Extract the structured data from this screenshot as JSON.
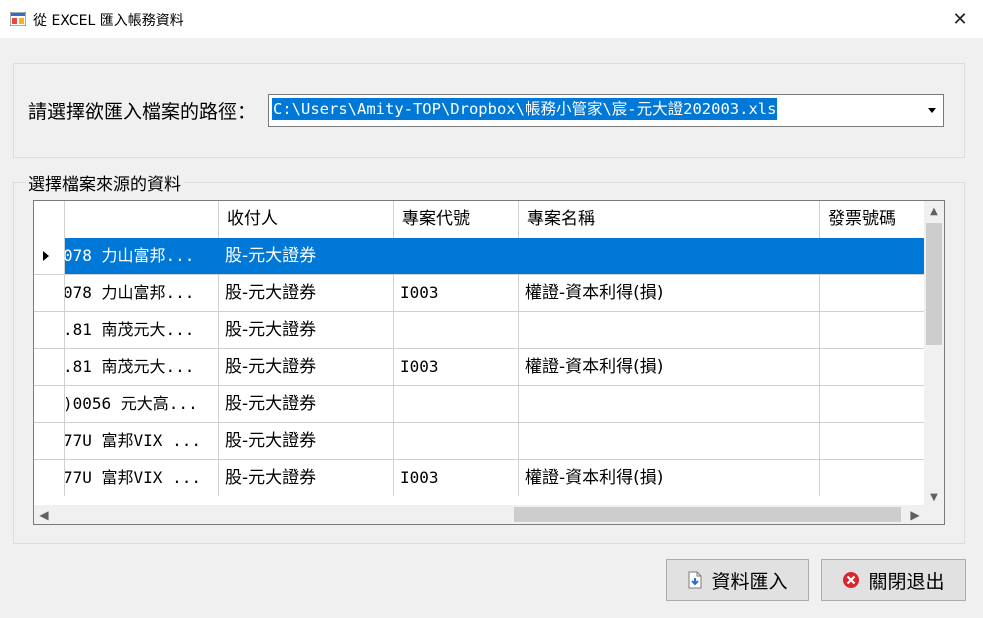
{
  "window": {
    "title": "從 EXCEL 匯入帳務資料",
    "close_glyph": "✕",
    "icon": "app-window-icon"
  },
  "path_section": {
    "label": "請選擇欲匯入檔案的路徑：",
    "selected_path": "C:\\Users\\Amity-TOP\\Dropbox\\帳務小管家\\宸-元大證202003.xls",
    "dropdown_icon": "chevron-down-icon"
  },
  "data_section": {
    "legend": "選擇檔案來源的資料"
  },
  "grid": {
    "columns": [
      "",
      "收付人",
      "專案代號",
      "專案名稱",
      "發票號碼"
    ],
    "rows": [
      {
        "item": "078 力山富邦...",
        "payee": "股-元大證券",
        "project_code": "",
        "project_name": "",
        "invoice": "",
        "selected": true
      },
      {
        "item": "078 力山富邦...",
        "payee": "股-元大證券",
        "project_code": "I003",
        "project_name": "權證-資本利得(損)",
        "invoice": ""
      },
      {
        "item": ".81 南茂元大...",
        "payee": "股-元大證券",
        "project_code": "",
        "project_name": "",
        "invoice": ""
      },
      {
        "item": ".81 南茂元大...",
        "payee": "股-元大證券",
        "project_code": "I003",
        "project_name": "權證-資本利得(損)",
        "invoice": ""
      },
      {
        "item": ")0056 元大高...",
        "payee": "股-元大證券",
        "project_code": "",
        "project_name": "",
        "invoice": ""
      },
      {
        "item": "77U 富邦VIX ...",
        "payee": "股-元大證券",
        "project_code": "",
        "project_name": "",
        "invoice": ""
      },
      {
        "item": "77U 富邦VIX ...",
        "payee": "股-元大證券",
        "project_code": "I003",
        "project_name": "權證-資本利得(損)",
        "invoice": ""
      }
    ],
    "scroll": {
      "up": "▲",
      "down": "▼",
      "left": "◀",
      "right": "▶"
    }
  },
  "buttons": {
    "import_label": "資料匯入",
    "close_label": "關閉退出"
  }
}
